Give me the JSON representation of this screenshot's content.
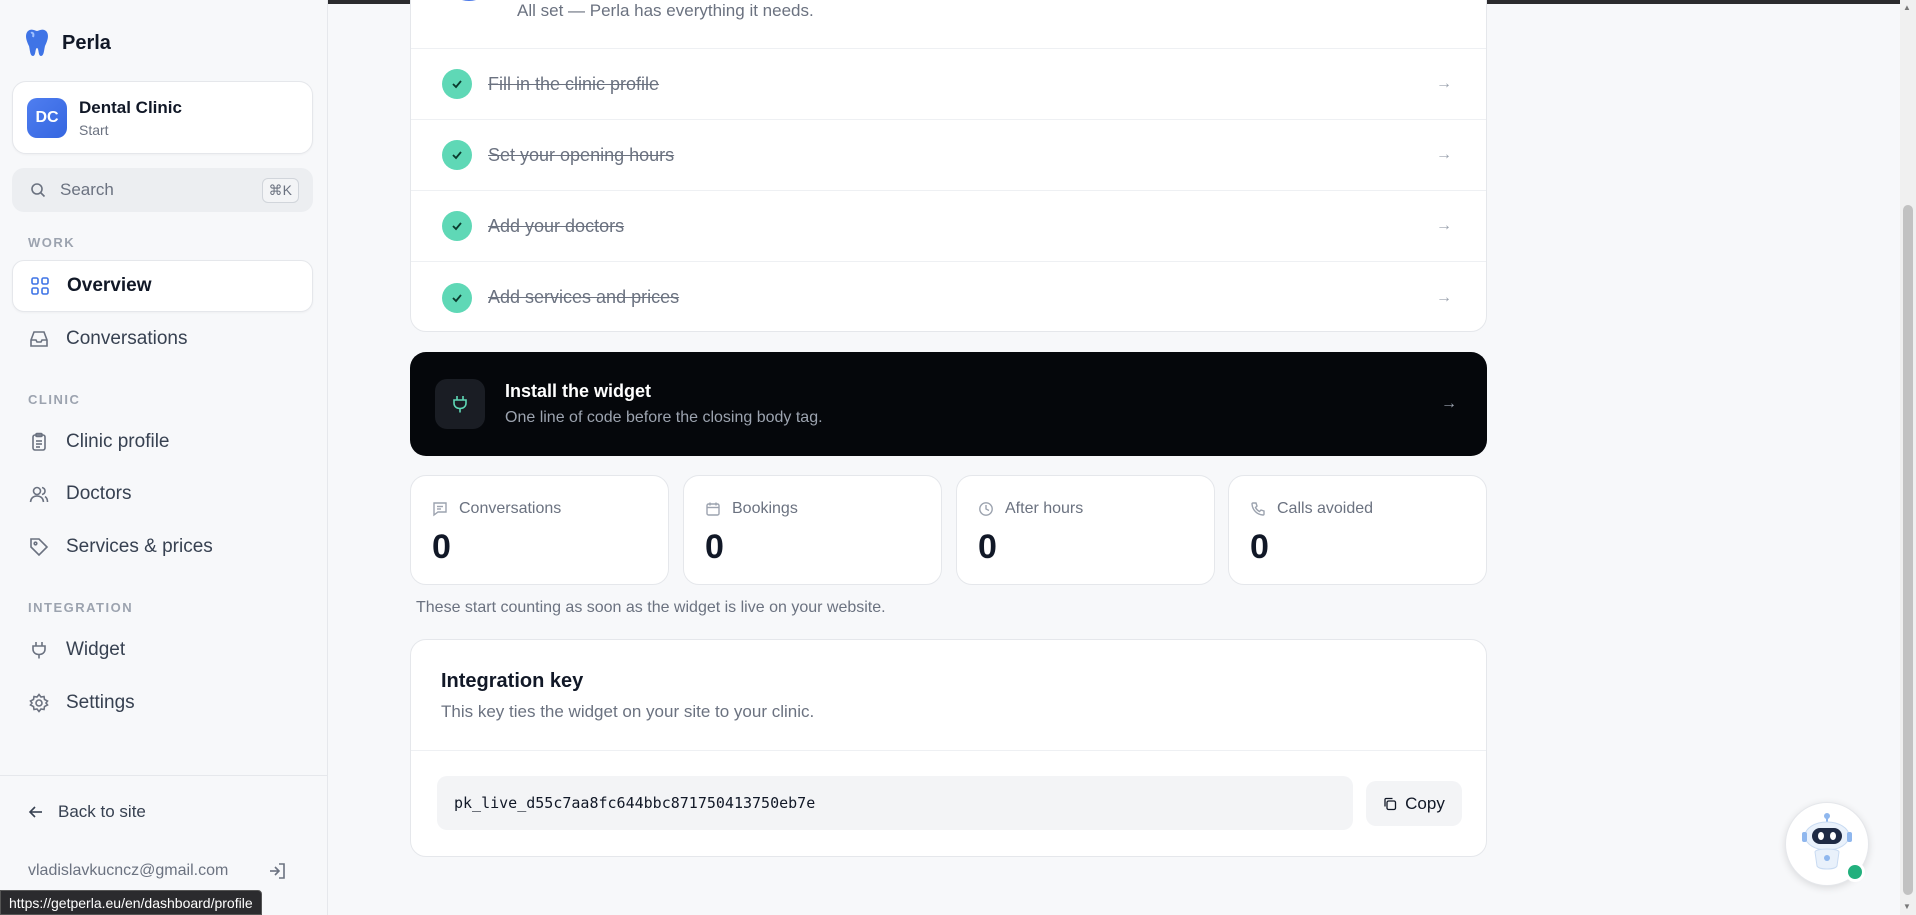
{
  "brand": {
    "name": "Perla"
  },
  "clinic": {
    "initials": "DC",
    "name": "Dental Clinic",
    "plan": "Start"
  },
  "search": {
    "placeholder": "Search",
    "shortcut": "⌘K"
  },
  "sidebar": {
    "sections": [
      {
        "label": "WORK"
      },
      {
        "label": "CLINIC"
      },
      {
        "label": "INTEGRATION"
      }
    ],
    "items": [
      {
        "label": "Overview",
        "icon": "grid-icon",
        "active": true
      },
      {
        "label": "Conversations",
        "icon": "inbox-icon"
      },
      {
        "label": "Clinic profile",
        "icon": "clipboard-icon"
      },
      {
        "label": "Doctors",
        "icon": "users-icon"
      },
      {
        "label": "Services & prices",
        "icon": "tag-icon"
      },
      {
        "label": "Widget",
        "icon": "plug-icon"
      },
      {
        "label": "Settings",
        "icon": "gear-icon"
      }
    ],
    "back_label": "Back to site",
    "user_email": "vladislavkucncz@gmail.com"
  },
  "status_url": "https://getperla.eu/en/dashboard/profile",
  "setup": {
    "status": "All set — Perla has everything it needs.",
    "steps": [
      {
        "label": "Fill in the clinic profile",
        "done": true
      },
      {
        "label": "Set your opening hours",
        "done": true
      },
      {
        "label": "Add your doctors",
        "done": true
      },
      {
        "label": "Add services and prices",
        "done": true
      }
    ]
  },
  "widget_banner": {
    "title": "Install the widget",
    "subtitle": "One line of code before the closing body tag."
  },
  "stats": [
    {
      "label": "Conversations",
      "value": "0",
      "icon": "chat-icon"
    },
    {
      "label": "Bookings",
      "value": "0",
      "icon": "calendar-icon"
    },
    {
      "label": "After hours",
      "value": "0",
      "icon": "clock-icon"
    },
    {
      "label": "Calls avoided",
      "value": "0",
      "icon": "phone-icon"
    }
  ],
  "stats_note": "These start counting as soon as the widget is live on your website.",
  "integration_key": {
    "title": "Integration key",
    "subtitle": "This key ties the widget on your site to your clinic.",
    "value": "pk_live_d55c7aa8fc644bbc871750413750eb7e",
    "copy_label": "Copy"
  },
  "colors": {
    "accent": "#4a78e8",
    "success": "#5fd8b6",
    "banner": "#05070b"
  }
}
